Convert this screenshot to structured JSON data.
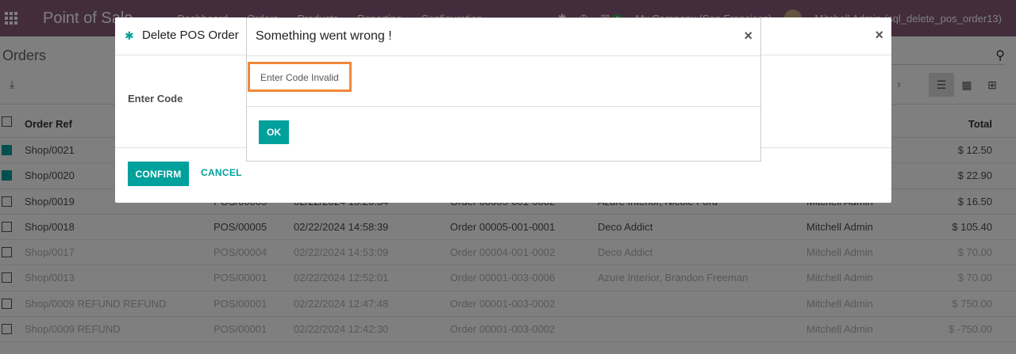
{
  "navbar": {
    "brand": "Point of Sale",
    "menu": [
      "Dashboard",
      "Orders",
      "Products",
      "Reporting",
      "Configuration"
    ],
    "chat_count": "2",
    "company": "My Company (San Francisco)",
    "user": "Mitchell Admin (sql_delete_pos_order13)"
  },
  "control_panel": {
    "title": "Orders"
  },
  "list": {
    "headers": {
      "ref": "Order Ref",
      "total": "Total"
    },
    "rows": [
      {
        "ref": "Shop/0021",
        "session": "",
        "date": "",
        "receipt": "",
        "customer": "",
        "employee": "",
        "total": "$ 12.50",
        "checked": true,
        "faded": false
      },
      {
        "ref": "Shop/0020",
        "session": "",
        "date": "",
        "receipt": "",
        "customer": "",
        "employee": "",
        "total": "$ 22.90",
        "checked": true,
        "faded": false
      },
      {
        "ref": "Shop/0019",
        "session": "POS/00005",
        "date": "02/22/2024 15:26:34",
        "receipt": "Order 00005-001-0002",
        "customer": "Azure Interior, Nicole Ford",
        "employee": "Mitchell Admin",
        "total": "$ 16.50",
        "checked": false,
        "faded": false
      },
      {
        "ref": "Shop/0018",
        "session": "POS/00005",
        "date": "02/22/2024 14:58:39",
        "receipt": "Order 00005-001-0001",
        "customer": "Deco Addict",
        "employee": "Mitchell Admin",
        "total": "$ 105.40",
        "checked": false,
        "faded": false
      },
      {
        "ref": "Shop/0017",
        "session": "POS/00004",
        "date": "02/22/2024 14:53:09",
        "receipt": "Order 00004-001-0002",
        "customer": "Deco Addict",
        "employee": "Mitchell Admin",
        "total": "$ 70.00",
        "checked": false,
        "faded": true
      },
      {
        "ref": "Shop/0013",
        "session": "POS/00001",
        "date": "02/22/2024 12:52:01",
        "receipt": "Order 00001-003-0006",
        "customer": "Azure Interior, Brandon Freeman",
        "employee": "Mitchell Admin",
        "total": "$ 70.00",
        "checked": false,
        "faded": true
      },
      {
        "ref": "Shop/0009 REFUND REFUND",
        "session": "POS/00001",
        "date": "02/22/2024 12:47:48",
        "receipt": "Order 00001-003-0002",
        "customer": "",
        "employee": "Mitchell Admin",
        "total": "$ 750.00",
        "checked": false,
        "faded": true
      },
      {
        "ref": "Shop/0009 REFUND",
        "session": "POS/00001",
        "date": "02/22/2024 12:42:30",
        "receipt": "Order 00001-003-0002",
        "customer": "",
        "employee": "Mitchell Admin",
        "total": "$ -750.00",
        "checked": false,
        "faded": true
      }
    ]
  },
  "delete_modal": {
    "title": "Delete POS Order",
    "close": "×",
    "field_label": "Enter Code",
    "confirm": "CONFIRM",
    "cancel": "CANCEL"
  },
  "error_modal": {
    "title": "Something went wrong !",
    "close": "×",
    "message": "Enter Code Invalid",
    "ok": "OK"
  },
  "colors": {
    "navbar": "#875a7b",
    "accent": "#00a09d",
    "highlight_border": "#f0883a"
  }
}
